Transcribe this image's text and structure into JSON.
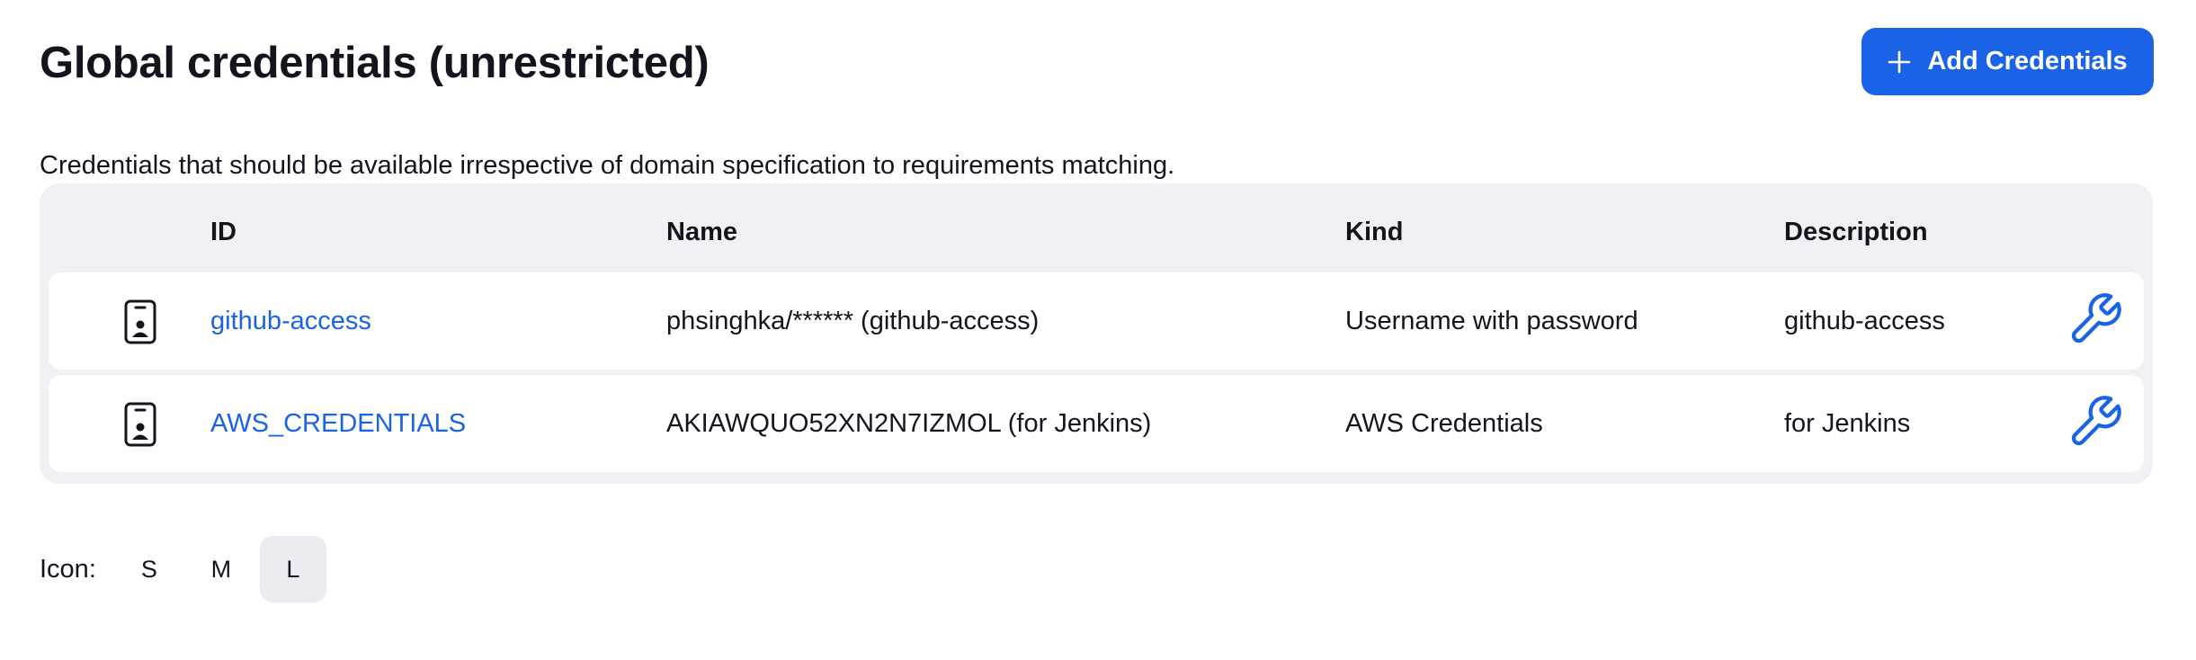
{
  "page": {
    "title": "Global credentials (unrestricted)",
    "description": "Credentials that should be available irrespective of domain specification to requirements matching."
  },
  "toolbar": {
    "add_label": "Add Credentials",
    "add_icon": "plus-icon"
  },
  "table": {
    "columns": {
      "id": "ID",
      "name": "Name",
      "kind": "Kind",
      "description": "Description"
    },
    "rows": [
      {
        "type_icon": "credential-phone-icon",
        "id": "github-access",
        "name": "phsinghka/****** (github-access)",
        "kind": "Username with password",
        "description": "github-access",
        "action_icon": "wrench-icon"
      },
      {
        "type_icon": "credential-phone-icon",
        "id": "AWS_CREDENTIALS",
        "name": "AKIAWQUO52XN2N7IZMOL (for Jenkins)",
        "kind": "AWS Credentials",
        "description": "for Jenkins",
        "action_icon": "wrench-icon"
      }
    ]
  },
  "icon_size": {
    "label": "Icon:",
    "options": [
      "S",
      "M",
      "L"
    ],
    "selected": "L"
  },
  "colors": {
    "accent": "#1b63e6",
    "table_background": "#f0f0f5",
    "text": "#14141f"
  }
}
